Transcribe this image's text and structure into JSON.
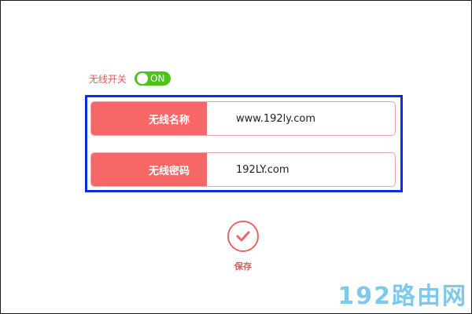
{
  "wifi_switch": {
    "label": "无线开关",
    "state_text": "ON",
    "enabled": true
  },
  "fields": {
    "ssid": {
      "label": "无线名称",
      "value": "www.192ly.com"
    },
    "password": {
      "label": "无线密码",
      "value": "192LY.com"
    }
  },
  "save": {
    "label": "保存",
    "icon": "checkmark-icon"
  },
  "watermark": "192路由网",
  "colors": {
    "accent": "#f76767",
    "toggle_on": "#4cc21b",
    "highlight_border": "#0a2fe0",
    "watermark": "#7ec8ee"
  }
}
